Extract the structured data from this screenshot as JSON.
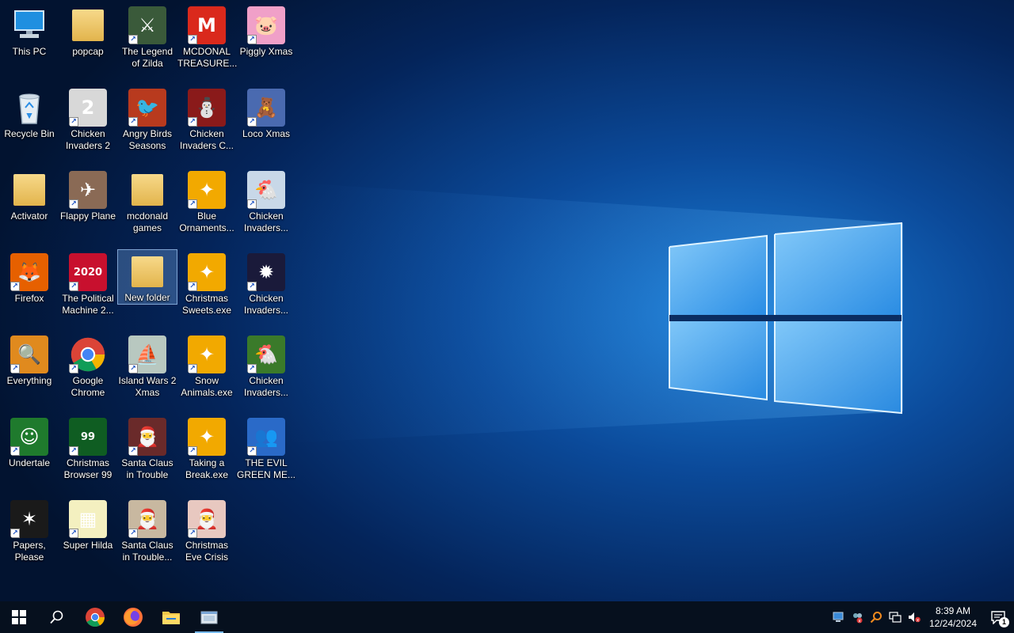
{
  "desktop": {
    "icons": [
      {
        "label": "This PC",
        "icon": "computer-icon",
        "col": 0,
        "row": 0,
        "type": "pc",
        "shortcut": false
      },
      {
        "label": "Recycle Bin",
        "icon": "recycle-bin-icon",
        "col": 0,
        "row": 1,
        "type": "rb",
        "shortcut": false
      },
      {
        "label": "Activator",
        "icon": "folder-icon",
        "col": 0,
        "row": 2,
        "type": "folder",
        "shortcut": false
      },
      {
        "label": "Firefox",
        "icon": "firefox-icon",
        "col": 0,
        "row": 3,
        "type": "app",
        "bg": "#e66000",
        "glyph": "🦊",
        "shortcut": true
      },
      {
        "label": "Everything",
        "icon": "search-magnifier-icon",
        "col": 0,
        "row": 4,
        "type": "app",
        "bg": "#e08a1e",
        "glyph": "🔍",
        "shortcut": true
      },
      {
        "label": "Undertale",
        "icon": "undertale-icon",
        "col": 0,
        "row": 5,
        "type": "app",
        "bg": "#1f7a2d",
        "glyph": "☺",
        "shortcut": true
      },
      {
        "label": "Papers, Please",
        "icon": "papers-please-icon",
        "col": 0,
        "row": 6,
        "type": "app",
        "bg": "#1a1a1a",
        "glyph": "✶",
        "shortcut": true
      },
      {
        "label": "popcap",
        "icon": "folder-icon",
        "col": 1,
        "row": 0,
        "type": "folder",
        "shortcut": false
      },
      {
        "label": "Chicken Invaders 2",
        "icon": "chicken-invaders-icon",
        "col": 1,
        "row": 1,
        "type": "app",
        "bg": "#d8d8d8",
        "glyph": "2",
        "shortcut": true
      },
      {
        "label": "Flappy Plane",
        "icon": "flappy-plane-icon",
        "col": 1,
        "row": 2,
        "type": "app",
        "bg": "#8a6a55",
        "glyph": "✈",
        "shortcut": true
      },
      {
        "label": "The Political Machine 2...",
        "icon": "political-machine-icon",
        "col": 1,
        "row": 3,
        "type": "app",
        "bg": "#c8102e",
        "glyph": "2020",
        "shortcut": true
      },
      {
        "label": "Google Chrome",
        "icon": "chrome-icon",
        "col": 1,
        "row": 4,
        "type": "chrome",
        "shortcut": true
      },
      {
        "label": "Christmas Browser 99",
        "icon": "christmas-tree-icon",
        "col": 1,
        "row": 5,
        "type": "app",
        "bg": "#0f5d22",
        "glyph": "99",
        "shortcut": true
      },
      {
        "label": "Super Hilda",
        "icon": "super-hilda-icon",
        "col": 1,
        "row": 6,
        "type": "app",
        "bg": "#f4f0c0",
        "glyph": "▦",
        "shortcut": true
      },
      {
        "label": "The Legend of Zilda",
        "icon": "legend-zilda-icon",
        "col": 2,
        "row": 0,
        "type": "app",
        "bg": "#3a5a3a",
        "glyph": "⚔",
        "shortcut": true
      },
      {
        "label": "Angry Birds Seasons",
        "icon": "angry-birds-icon",
        "col": 2,
        "row": 1,
        "type": "app",
        "bg": "#b83a1e",
        "glyph": "🐦",
        "shortcut": true
      },
      {
        "label": "mcdonald games",
        "icon": "folder-icon",
        "col": 2,
        "row": 2,
        "type": "folder",
        "shortcut": false
      },
      {
        "label": "New folder",
        "icon": "folder-icon",
        "col": 2,
        "row": 3,
        "type": "folder",
        "shortcut": false,
        "selected": true
      },
      {
        "label": "Island Wars 2 Xmas",
        "icon": "island-wars-icon",
        "col": 2,
        "row": 4,
        "type": "app",
        "bg": "#b8c8c0",
        "glyph": "⛵",
        "shortcut": true
      },
      {
        "label": "Santa Claus in Trouble",
        "icon": "santa-claus-icon",
        "col": 2,
        "row": 5,
        "type": "app",
        "bg": "#6a2a2a",
        "glyph": "🎅",
        "shortcut": true
      },
      {
        "label": "Santa Claus in Trouble...",
        "icon": "santa-claus-icon",
        "col": 2,
        "row": 6,
        "type": "app",
        "bg": "#c8b8a0",
        "glyph": "🎅",
        "shortcut": true
      },
      {
        "label": "MCDONAL TREASURE...",
        "icon": "mcdonalds-icon",
        "col": 3,
        "row": 0,
        "type": "app",
        "bg": "#da291c",
        "glyph": "M",
        "shortcut": true
      },
      {
        "label": "Chicken Invaders C...",
        "icon": "chicken-invaders-icon",
        "col": 3,
        "row": 1,
        "type": "app",
        "bg": "#8a1a1a",
        "glyph": "⛄",
        "shortcut": true
      },
      {
        "label": "Blue Ornaments...",
        "icon": "popcap-game-icon",
        "col": 3,
        "row": 2,
        "type": "app",
        "bg": "#f2a900",
        "glyph": "✦",
        "shortcut": true
      },
      {
        "label": "Christmas Sweets.exe",
        "icon": "popcap-game-icon",
        "col": 3,
        "row": 3,
        "type": "app",
        "bg": "#f2a900",
        "glyph": "✦",
        "shortcut": true
      },
      {
        "label": "Snow Animals.exe",
        "icon": "popcap-game-icon",
        "col": 3,
        "row": 4,
        "type": "app",
        "bg": "#f2a900",
        "glyph": "✦",
        "shortcut": true
      },
      {
        "label": "Taking a Break.exe",
        "icon": "popcap-game-icon",
        "col": 3,
        "row": 5,
        "type": "app",
        "bg": "#f2a900",
        "glyph": "✦",
        "shortcut": true
      },
      {
        "label": "Christmas Eve Crisis",
        "icon": "santa-face-icon",
        "col": 3,
        "row": 6,
        "type": "app",
        "bg": "#e8c8c0",
        "glyph": "🎅",
        "shortcut": true
      },
      {
        "label": "Piggly Xmas",
        "icon": "piggly-icon",
        "col": 4,
        "row": 0,
        "type": "app",
        "bg": "#f0a0c8",
        "glyph": "🐷",
        "shortcut": true
      },
      {
        "label": "Loco Xmas",
        "icon": "teddy-bear-icon",
        "col": 4,
        "row": 1,
        "type": "app",
        "bg": "#4a6ab0",
        "glyph": "🧸",
        "shortcut": true
      },
      {
        "label": "Chicken Invaders...",
        "icon": "chicken-invaders-icon",
        "col": 4,
        "row": 2,
        "type": "app",
        "bg": "#c8d8e8",
        "glyph": "🐔",
        "shortcut": true
      },
      {
        "label": "Chicken Invaders...",
        "icon": "chicken-invaders-icon",
        "col": 4,
        "row": 3,
        "type": "app",
        "bg": "#1a1a3a",
        "glyph": "✹",
        "shortcut": true
      },
      {
        "label": "Chicken Invaders...",
        "icon": "chicken-invaders-icon",
        "col": 4,
        "row": 4,
        "type": "app",
        "bg": "#3a7a2a",
        "glyph": "🐔",
        "shortcut": true
      },
      {
        "label": "THE EVIL GREEN ME...",
        "icon": "msn-messenger-icon",
        "col": 4,
        "row": 5,
        "type": "app",
        "bg": "#2a6ac8",
        "glyph": "👥",
        "shortcut": true
      }
    ]
  },
  "taskbar": {
    "items": [
      {
        "name": "start-button",
        "icon": "windows-logo-icon"
      },
      {
        "name": "search-button",
        "icon": "search-icon"
      },
      {
        "name": "taskbar-chrome",
        "icon": "chrome-icon"
      },
      {
        "name": "taskbar-firefox",
        "icon": "firefox-icon"
      },
      {
        "name": "taskbar-file-explorer",
        "icon": "folder-icon"
      },
      {
        "name": "taskbar-running-app",
        "icon": "app-window-icon",
        "active": true
      }
    ],
    "tray": {
      "icons": [
        "display-icon",
        "network-device-error-icon",
        "everything-search-icon",
        "network-icon",
        "volume-muted-icon"
      ],
      "time": "8:39 AM",
      "date": "12/24/2024",
      "notifications": "1"
    }
  }
}
